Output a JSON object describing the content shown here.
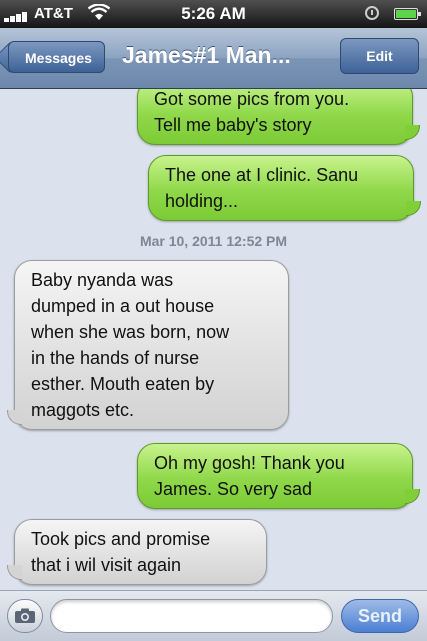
{
  "status_bar": {
    "carrier": "AT&T",
    "time": "5:26 AM"
  },
  "nav": {
    "back_label": "Messages",
    "title": "James#1 Man...",
    "edit_label": "Edit"
  },
  "messages": [
    {
      "type": "sent",
      "text": "Got some pics from you.\nTell me baby's story"
    },
    {
      "type": "sent",
      "text": "The one at I clinic. Sanu\nholding..."
    },
    {
      "type": "received",
      "text": "Baby nyanda was\ndumped in a out house\nwhen she was born, now\nin the hands of nurse\nesther. Mouth eaten by\nmaggots etc."
    },
    {
      "type": "sent",
      "text": "Oh my gosh!   Thank you\nJames.  So very sad"
    },
    {
      "type": "received",
      "text": "Took pics and promise\nthat i wil visit again"
    }
  ],
  "timestamp": "Mar 10, 2011 12:52 PM",
  "input": {
    "placeholder": "",
    "value": "",
    "send_label": "Send"
  },
  "colors": {
    "sent_bubble": "#8fd84a",
    "received_bubble": "#e1e1e1",
    "nav_bar": "#8ca3c1"
  },
  "icons": {
    "signal": "signal-bars-icon",
    "wifi": "wifi-icon",
    "lock": "rotation-lock-icon",
    "battery": "battery-icon",
    "camera": "camera-icon"
  }
}
